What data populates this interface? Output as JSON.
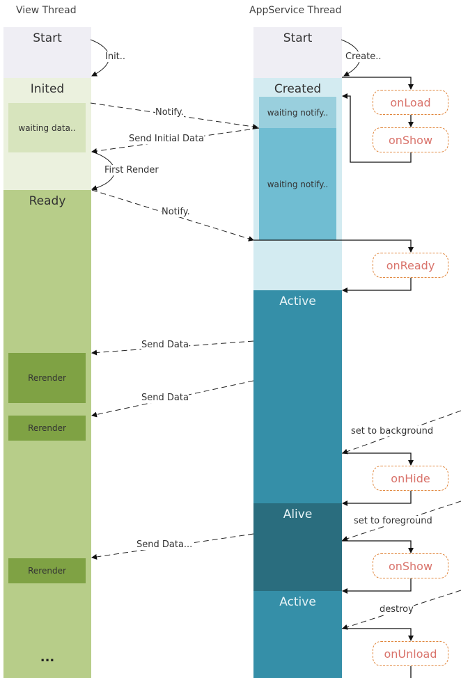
{
  "threads": {
    "view": {
      "title": "View Thread"
    },
    "service": {
      "title": "AppService Thread"
    }
  },
  "view_states": {
    "start": "Start",
    "inited": "Inited",
    "waiting_data": "waiting data..",
    "ready": "Ready",
    "rerender_1": "Rerender",
    "rerender_2": "Rerender",
    "rerender_3": "Rerender",
    "ellipsis": "..."
  },
  "service_states": {
    "start": "Start",
    "created": "Created",
    "waiting_notify_1": "waiting notify..",
    "waiting_notify_2": "waiting notify..",
    "active_1": "Active",
    "alive": "Alive",
    "active_2": "Active"
  },
  "hooks": {
    "on_load": "onLoad",
    "on_show_1": "onShow",
    "on_ready": "onReady",
    "on_hide": "onHide",
    "on_show_2": "onShow",
    "on_unload": "onUnload"
  },
  "edge_labels": {
    "init": "Init..",
    "create": "Create..",
    "notify_1": "Notify.",
    "send_initial_data": "Send Initial Data",
    "first_render": "First Render",
    "notify_2": "Notify.",
    "send_data_1": "Send Data",
    "send_data_2": "Send Data",
    "send_data_3": "Send Data...",
    "set_to_background": "set to background",
    "set_to_foreground": "set to foreground",
    "destroy": "destroy"
  },
  "colors": {
    "start_bg": "#efeef4",
    "inited_bg": "#ebf1de",
    "waiting_data_bg": "#d7e4bd",
    "ready_bg": "#b7cd89",
    "rerender_bg": "#7fa244",
    "created_bg": "#d3ebf1",
    "waiting_notify_1_bg": "#99cfdd",
    "waiting_notify_2_bg": "#70bdd2",
    "active_bg": "#358fa8",
    "alive_bg": "#2a6d7e",
    "hook_border": "#e0853a",
    "hook_text": "#d9736b"
  }
}
